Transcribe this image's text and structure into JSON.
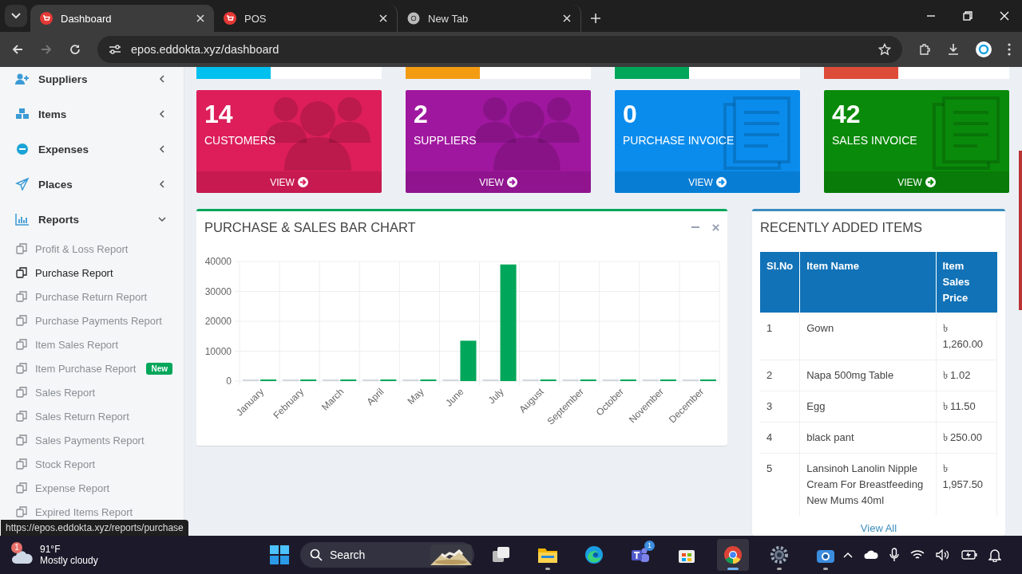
{
  "browser": {
    "tabs": [
      {
        "label": "Dashboard",
        "kind": "cart",
        "selected": true
      },
      {
        "label": "POS",
        "kind": "cart",
        "selected": false
      },
      {
        "label": "New Tab",
        "kind": "chrome",
        "selected": false
      }
    ],
    "url": "epos.eddokta.xyz/dashboard"
  },
  "sidebar": {
    "items": [
      {
        "label": "Suppliers",
        "kind": "suppliers",
        "expanded": false
      },
      {
        "label": "Items",
        "kind": "items",
        "expanded": false
      },
      {
        "label": "Expenses",
        "kind": "expenses",
        "expanded": false
      },
      {
        "label": "Places",
        "kind": "places",
        "expanded": false
      },
      {
        "label": "Reports",
        "kind": "reports",
        "expanded": true,
        "children": [
          {
            "label": "Profit & Loss Report",
            "hovered": false
          },
          {
            "label": "Purchase Report",
            "hovered": true
          },
          {
            "label": "Purchase Return Report",
            "hovered": false
          },
          {
            "label": "Purchase Payments Report",
            "hovered": false
          },
          {
            "label": "Item Sales Report",
            "hovered": false
          },
          {
            "label": "Item Purchase Report",
            "hovered": false,
            "badge": "New"
          },
          {
            "label": "Sales Report",
            "hovered": false
          },
          {
            "label": "Sales Return Report",
            "hovered": false
          },
          {
            "label": "Sales Payments Report",
            "hovered": false
          },
          {
            "label": "Stock Report",
            "hovered": false
          },
          {
            "label": "Expense Report",
            "hovered": false
          },
          {
            "label": "Expired Items Report",
            "hovered": false
          }
        ]
      }
    ]
  },
  "partial_boxes": [
    {
      "color": "#00c0ef",
      "level": 0.4
    },
    {
      "color": "#f39c12",
      "level": 0.4
    },
    {
      "color": "#00a65a",
      "level": 0.4
    },
    {
      "color": "#dd4b39",
      "level": 0.4
    }
  ],
  "stat_cards": [
    {
      "value": "14",
      "label": "CUSTOMERS",
      "link": "VIEW",
      "color": "#dd1e5a",
      "kind": "people"
    },
    {
      "value": "2",
      "label": "SUPPLIERS",
      "link": "VIEW",
      "color": "#a0179f",
      "kind": "people"
    },
    {
      "value": "0",
      "label": "PURCHASE INVOICE",
      "link": "VIEW",
      "color": "#0a8ced",
      "kind": "invoice"
    },
    {
      "value": "42",
      "label": "SALES INVOICE",
      "link": "VIEW",
      "color": "#0a8a0a",
      "kind": "invoice"
    }
  ],
  "bar_chart": {
    "chart_data": {
      "type": "bar",
      "title": "PURCHASE & SALES BAR CHART",
      "categories": [
        "January",
        "February",
        "March",
        "April",
        "May",
        "June",
        "July",
        "August",
        "September",
        "October",
        "November",
        "December"
      ],
      "series": [
        {
          "color": "#d2d6de",
          "values": [
            0,
            0,
            0,
            0,
            0,
            0,
            0,
            0,
            0,
            0,
            0,
            0
          ]
        },
        {
          "color": "#00a65a",
          "values": [
            0,
            0,
            0,
            0,
            0,
            13500,
            39000,
            0,
            0,
            0,
            0,
            0
          ]
        }
      ],
      "ylim": [
        0,
        40000
      ],
      "yticks": [
        0,
        10000,
        20000,
        30000,
        40000
      ],
      "grid": true
    }
  },
  "recent_items": {
    "title": "RECENTLY ADDED ITEMS",
    "columns": [
      "Sl.No",
      "Item Name",
      "Item Sales Price"
    ],
    "rows": [
      [
        "1",
        "Gown",
        "৳ 1,260.00"
      ],
      [
        "2",
        "Napa 500mg Table",
        "৳ 1.02"
      ],
      [
        "3",
        "Egg",
        "৳ 11.50"
      ],
      [
        "4",
        "black pant",
        "৳ 250.00"
      ],
      [
        "5",
        "Lansinoh Lanolin Nipple Cream For Breastfeeding New Mums 40ml",
        "৳ 1,957.50"
      ]
    ],
    "link": "View All"
  },
  "status_url": "https://epos.eddokta.xyz/reports/purchase",
  "taskbar": {
    "weather": {
      "badge": "1",
      "temp": "91°F",
      "desc": "Mostly cloudy"
    },
    "search": {
      "placeholder": "Search"
    },
    "apps": [
      {
        "kind": "task-view",
        "running": false,
        "active": false
      },
      {
        "kind": "files",
        "running": true,
        "active": false
      },
      {
        "kind": "edge",
        "running": false,
        "active": false
      },
      {
        "kind": "teams",
        "running": false,
        "active": false,
        "badge": "1"
      },
      {
        "kind": "store",
        "running": false,
        "active": false
      },
      {
        "kind": "chrome",
        "running": true,
        "active": true
      },
      {
        "kind": "settings",
        "running": true,
        "active": false
      },
      {
        "kind": "camera",
        "running": true,
        "active": false
      }
    ]
  }
}
